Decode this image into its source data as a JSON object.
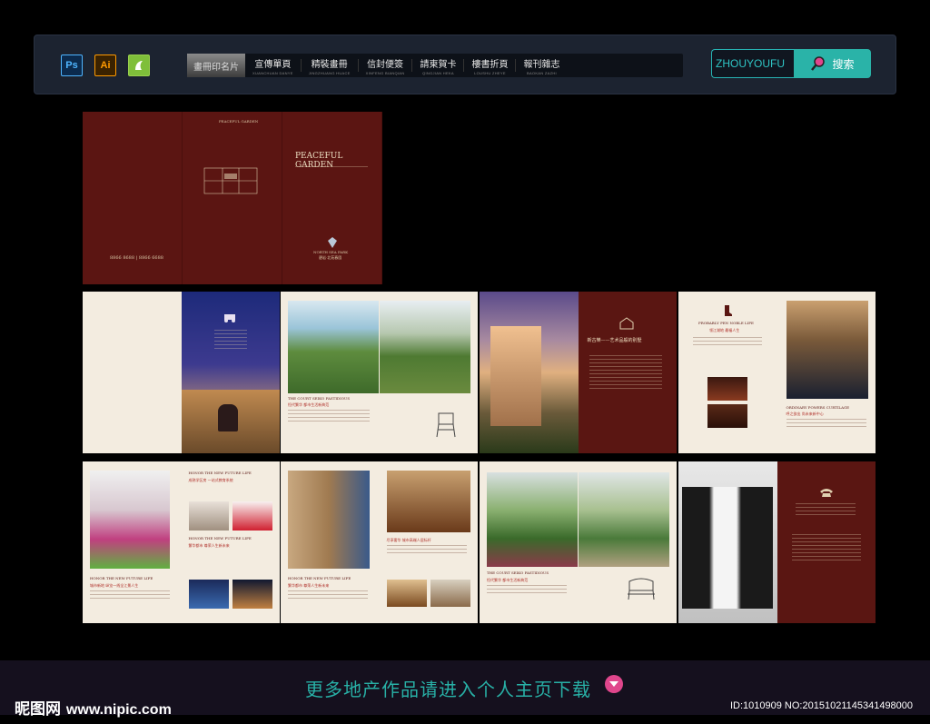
{
  "toolbar": {
    "apps": [
      "Ps",
      "Ai",
      "Cd"
    ],
    "nav": [
      {
        "label": "畫冊印名片",
        "sub": "",
        "active": true
      },
      {
        "label": "宣傳單頁",
        "sub": "XUANCHUAN DANYE"
      },
      {
        "label": "精裝畫冊",
        "sub": "JINGZHUANG HUACE"
      },
      {
        "label": "信封便簽",
        "sub": "XINFENG BIANQIAN"
      },
      {
        "label": "請柬賀卡",
        "sub": "QINGJIAN HEKA"
      },
      {
        "label": "樓書折頁",
        "sub": "LOUSHU ZHEYE"
      },
      {
        "label": "報刊雜志",
        "sub": "BAOKAN ZAZHI"
      }
    ],
    "search_value": "ZHOUYOUFU",
    "search_button": "搜索"
  },
  "brochure": {
    "cover_title": "PEACEFUL GARDEN",
    "cover_small_title": "PEACEFUL GARDEN",
    "cover_brand": "NORTH SEA PARK",
    "cover_brand_cn": "碧岩·北苑春園",
    "cover_phone": "8866 8688 | 8866 6688",
    "court_title_1": "THE COURT SEIKO FASTIDIOUS",
    "court_sub_1": "恒代繁华 都市生活新典范",
    "art_villa": "新古樂——艺术品般的别墅",
    "noble_life": "PROBABLY PEN  NOBLE LIFE",
    "noble_cn": "领江湖地 最福人生",
    "ordinary_title": "ORDINARY POWERS CURTILAGE",
    "ordinary_cn": "呼之欲出 尚未来新中心",
    "honor_1": "HONOR THE NEW FUTURE LIFE",
    "honor_cn_1": "成熟学区房 一站式教育系统",
    "honor_2": "HONOR THE NEW FUTURE LIFE",
    "honor_cn_2": "繁华都市 尊荣人生新未来",
    "honor_3": "HONOR THE NEW FUTURE LIFE",
    "honor_cn_3": "城市新地 纵览一线全江景人生",
    "honor_4": "HONOR THE NEW FUTURE LIFE",
    "honor_cn_4": "繁华都市 尊荣人生新未来",
    "honor_cn_5": "尽享奢华 城市高端人居标杆",
    "court_title_2": "THE COURT SEIKO FASTIDIOUS",
    "court_sub_2": "恒代繁华 都市生活新典范"
  },
  "footer": {
    "cta": "更多地产作品请进入个人主页下载",
    "logo_cn": "昵图网",
    "logo_url": "www.nipic.com",
    "id_text": "ID:1010909 NO:20151021145341498000"
  },
  "colors": {
    "maroon": "#5a1612",
    "cream": "#f3ece0",
    "accent": "#28b0a6"
  }
}
